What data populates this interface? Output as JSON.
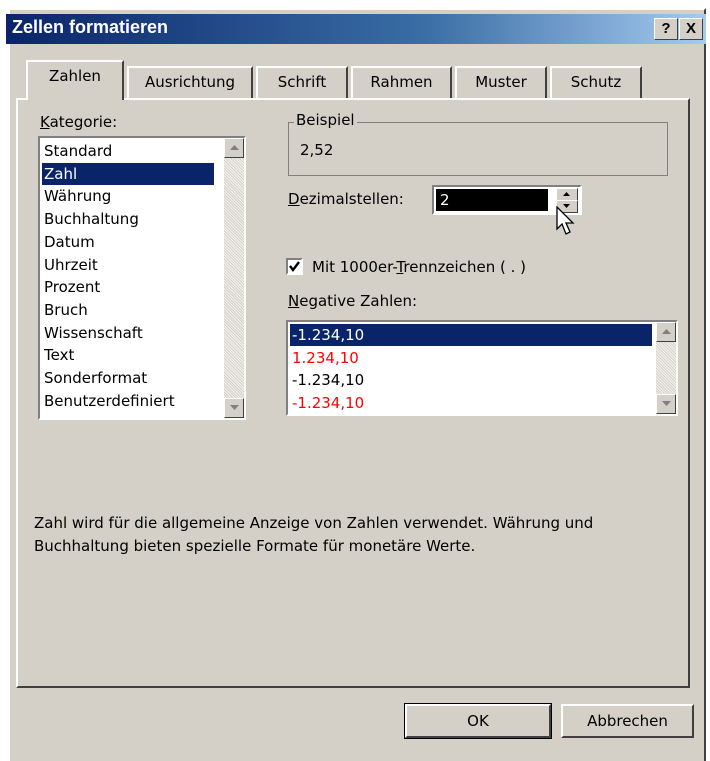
{
  "window": {
    "title": "Zellen formatieren",
    "help_button": "?",
    "close_button": "X"
  },
  "tabs": [
    "Zahlen",
    "Ausrichtung",
    "Schrift",
    "Rahmen",
    "Muster",
    "Schutz"
  ],
  "kategorie": {
    "label_underlined": "K",
    "label_rest": "ategorie:",
    "items": [
      "Standard",
      "Zahl",
      "Währung",
      "Buchhaltung",
      "Datum",
      "Uhrzeit",
      "Prozent",
      "Bruch",
      "Wissenschaft",
      "Text",
      "Sonderformat",
      "Benutzerdefiniert"
    ],
    "selected": "Zahl"
  },
  "beispiel": {
    "legend": "Beispiel",
    "value": "2,52"
  },
  "dezimalstellen": {
    "label_underlined": "D",
    "label_rest": "ezimalstellen:",
    "value": "2"
  },
  "trennzeichen": {
    "label_pre": "Mit 1000er-",
    "label_underlined": "T",
    "label_rest": "rennzeichen ( . )",
    "checked": true
  },
  "negative": {
    "label_underlined": "N",
    "label_rest": "egative Zahlen:",
    "items": [
      {
        "text": "-1.234,10",
        "color": "#000000",
        "selected": true
      },
      {
        "text": "1.234,10",
        "color": "#ff0000"
      },
      {
        "text": "-1.234,10",
        "color": "#000000"
      },
      {
        "text": "-1.234,10",
        "color": "#ff0000"
      }
    ]
  },
  "description": "Zahl wird für die allgemeine Anzeige von Zahlen verwendet. Währung und Buchhaltung bieten spezielle Formate für monetäre Werte.",
  "buttons": {
    "ok": "OK",
    "cancel": "Abbrechen"
  },
  "colors": {
    "title_start": "#0a246a",
    "title_end": "#a6caf0",
    "dialog_bg": "#d4d0c8",
    "selection": "#0a246a",
    "negative_red": "#ff0000"
  }
}
